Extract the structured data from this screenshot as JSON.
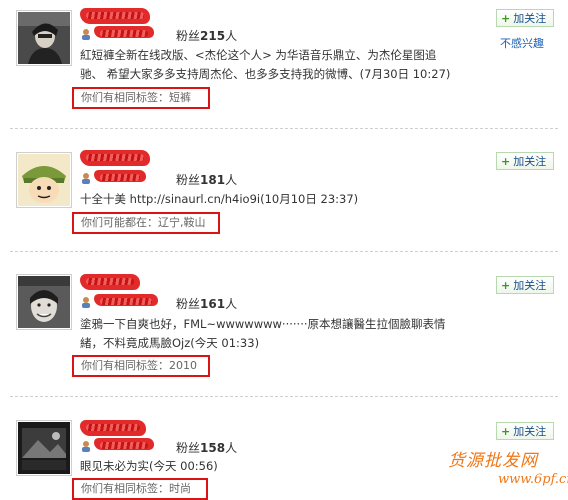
{
  "feed": {
    "follow_label": "加关注",
    "follow_plus": "+",
    "not_interested": "不感兴趣",
    "items": [
      {
        "fans_prefix": "粉丝",
        "fans_count": "215",
        "fans_suffix": "人",
        "text_line1": "紅短褲全新在线改版、<杰伦这个人> 为华语音乐鼎立、为杰伦星图追",
        "text_line2": "驰、 希望大家多多支持周杰伦、也多多支持我的微博、(7月30日 10:27)",
        "tag_label": "你们有相同标签：",
        "tag_value": "短裤"
      },
      {
        "fans_prefix": "粉丝",
        "fans_count": "181",
        "fans_suffix": "人",
        "text_line1": "十全十美  http://sinaurl.cn/h4io9i(10月10日  23:37)",
        "tag_label": "你们可能都在：",
        "tag_value": "辽宁,鞍山"
      },
      {
        "fans_prefix": "粉丝",
        "fans_count": "161",
        "fans_suffix": "人",
        "text_line1": "塗鴉一下自爽也好，FML~wwwwwww·······原本想讓醫生拉個臉聊表情",
        "text_line2": "緒，不料竟成馬臉Ojz(今天  01:33)",
        "tag_label": "你们有相同标签：",
        "tag_value": "2010"
      },
      {
        "fans_prefix": "粉丝",
        "fans_count": "158",
        "fans_suffix": "人",
        "text_line1": "眼见未必为实(今天  00:56)",
        "tag_label": "你们有相同标签：",
        "tag_value": "时尚"
      }
    ]
  },
  "watermark": {
    "line1": "货源批发网",
    "line2": "www.6pf.cn"
  },
  "colors": {
    "highlight_box": "#d81414",
    "link": "#1a5fb4",
    "follow_plus": "#3a9a1a",
    "watermark": "#f07818"
  }
}
